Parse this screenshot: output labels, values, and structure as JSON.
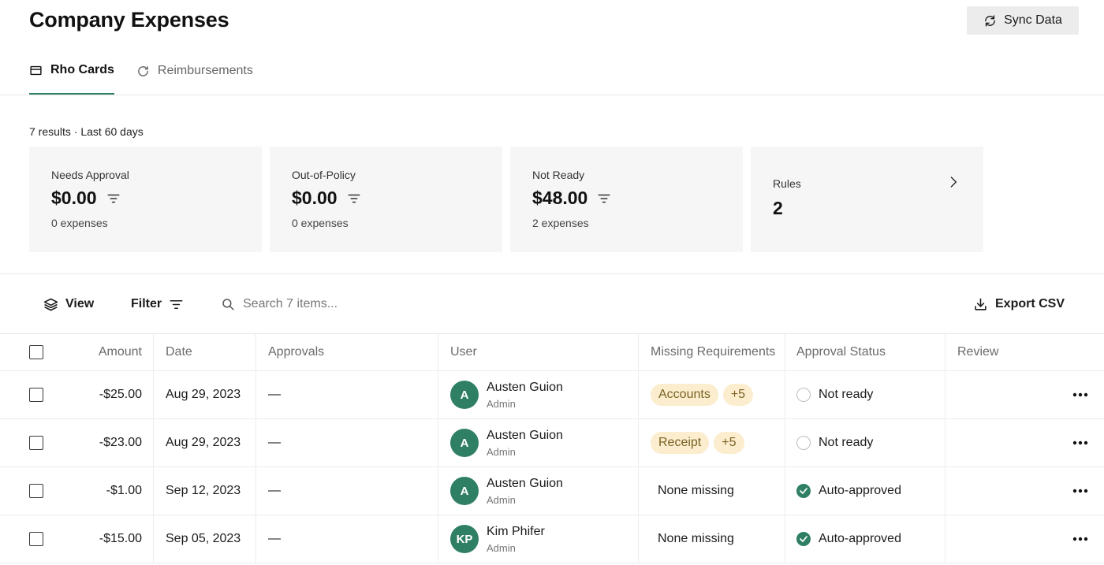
{
  "header": {
    "title": "Company Expenses",
    "sync_label": "Sync Data"
  },
  "tabs": [
    {
      "label": "Rho Cards",
      "icon": "card-icon",
      "active": true
    },
    {
      "label": "Reimbursements",
      "icon": "refresh-icon",
      "active": false
    }
  ],
  "results_summary": "7 results · Last 60 days",
  "summary_cards": [
    {
      "label": "Needs Approval",
      "value": "$0.00",
      "sub": "0 expenses"
    },
    {
      "label": "Out-of-Policy",
      "value": "$0.00",
      "sub": "0 expenses"
    },
    {
      "label": "Not Ready",
      "value": "$48.00",
      "sub": "2 expenses"
    },
    {
      "label": "Rules",
      "value": "2"
    }
  ],
  "toolbar": {
    "view_label": "View",
    "filter_label": "Filter",
    "search_placeholder": "Search 7 items...",
    "export_label": "Export CSV"
  },
  "table": {
    "columns": {
      "amount": "Amount",
      "date": "Date",
      "approvals": "Approvals",
      "user": "User",
      "missing": "Missing Requirements",
      "status": "Approval Status",
      "review": "Review"
    },
    "rows": [
      {
        "amount": "-$25.00",
        "date": "Aug 29, 2023",
        "approvals": "—",
        "initials": "A",
        "user": "Austen Guion",
        "role": "Admin",
        "missing": [
          "Accounts",
          "+5"
        ],
        "missing_text": "",
        "status": "Not ready",
        "status_type": "ring"
      },
      {
        "amount": "-$23.00",
        "date": "Aug 29, 2023",
        "approvals": "—",
        "initials": "A",
        "user": "Austen Guion",
        "role": "Admin",
        "missing": [
          "Receipt",
          "+5"
        ],
        "missing_text": "",
        "status": "Not ready",
        "status_type": "ring"
      },
      {
        "amount": "-$1.00",
        "date": "Sep 12, 2023",
        "approvals": "—",
        "initials": "A",
        "user": "Austen Guion",
        "role": "Admin",
        "missing": [],
        "missing_text": "None missing",
        "status": "Auto-approved",
        "status_type": "check"
      },
      {
        "amount": "-$15.00",
        "date": "Sep 05, 2023",
        "approvals": "—",
        "initials": "KP",
        "user": "Kim Phifer",
        "role": "Admin",
        "missing": [],
        "missing_text": "None missing",
        "status": "Auto-approved",
        "status_type": "check"
      }
    ]
  },
  "colors": {
    "accent": "#2f7f65",
    "pill_bg": "#fbedce",
    "pill_text": "#7a6224",
    "card_bg": "#f6f6f6"
  }
}
